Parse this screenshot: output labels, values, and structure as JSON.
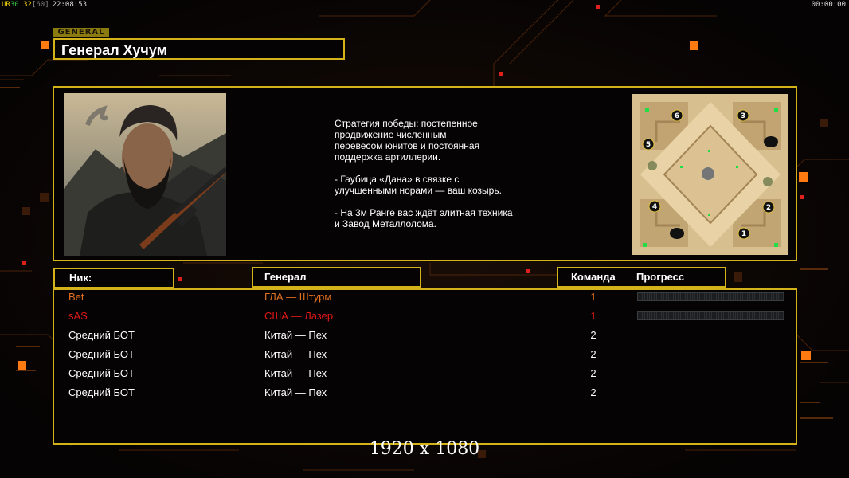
{
  "topbar": {
    "ur_label": "UR",
    "fps_a": "30",
    "fps_b": "32",
    "fps_c": "[60]",
    "clock": "22:08:53",
    "timer": "00:00:00"
  },
  "general_tag": "GENERAL",
  "general_title": "Генерал Хучум",
  "description": "Стратегия победы: постепенное\nпродвижение численным\nперевесом юнитов и постоянная\nподдержка артиллерии.\n\n- Гаубица «Дана» в связке с\nулучшенными норами — ваш козырь.\n\n- На 3м Ранге вас ждёт элитная техника\nи Завод Металлолома.",
  "headers": {
    "nick": "Ник:",
    "general": "Генерал",
    "team": "Команда",
    "progress": "Прогресс"
  },
  "players": [
    {
      "nick": "Bet",
      "general": "ГЛА — Штурм",
      "team": "1",
      "color": "#e07020",
      "has_progress": true
    },
    {
      "nick": "sAS",
      "general": "США — Лазер",
      "team": "1",
      "color": "#e01818",
      "has_progress": true
    },
    {
      "nick": "Средний БОТ",
      "general": "Китай — Пех",
      "team": "2",
      "color": "#ffffff",
      "has_progress": false
    },
    {
      "nick": "Средний БОТ",
      "general": "Китай — Пех",
      "team": "2",
      "color": "#ffffff",
      "has_progress": false
    },
    {
      "nick": "Средний БОТ",
      "general": "Китай — Пех",
      "team": "2",
      "color": "#ffffff",
      "has_progress": false
    },
    {
      "nick": "Средний БОТ",
      "general": "Китай — Пех",
      "team": "2",
      "color": "#ffffff",
      "has_progress": false
    }
  ],
  "map_start_positions": [
    "1",
    "2",
    "3",
    "4",
    "5",
    "6"
  ],
  "resolution": "1920 x 1080",
  "colors": {
    "frame": "#d4b21a",
    "accent": "#ff7a10"
  }
}
